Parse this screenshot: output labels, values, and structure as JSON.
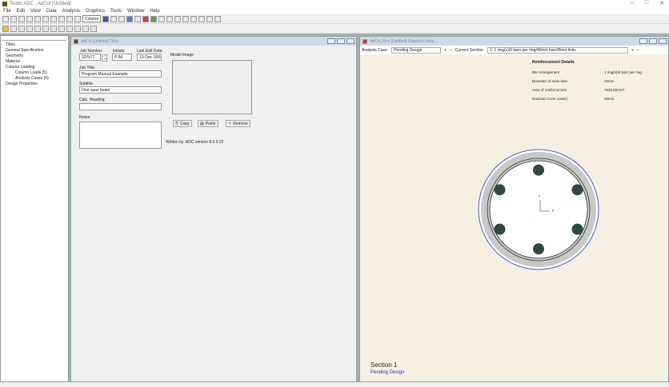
{
  "app": {
    "title": "Tedds ADC - AdCol [Untitled]",
    "min": "–",
    "max": "□",
    "close": "✕"
  },
  "menu": [
    "File",
    "Edit",
    "View",
    "Data",
    "Analysis",
    "Graphics",
    "Tools",
    "Window",
    "Help"
  ],
  "toolbar": {
    "dropdown": "Column"
  },
  "tree": {
    "items": [
      "Titles",
      "General Specification",
      "Geometry",
      "Material",
      "Column Loading"
    ],
    "children": [
      "Column Loads (5)",
      "Analysis Cases (5)"
    ],
    "last": "Design Properties"
  },
  "titles_window": {
    "title": "AdCol [Untitled] Titles",
    "job_number_label": "Job Number:",
    "job_number": "32/5/72",
    "initials_label": "Initials:",
    "initials": "PJM",
    "last_edit_label": "Last Edit Date:",
    "last_edit": "13-Dec-2004",
    "job_title_label": "Job Title:",
    "job_title": "Program Manual Example",
    "subtitle_label": "Subtitle:",
    "subtitle": "One span beam",
    "calc_heading_label": "Calc. Heading:",
    "calc_heading": "",
    "notes_label": "Notes:",
    "notes": "",
    "model_image_label": "Model Image",
    "copy": "Copy",
    "paste": "Paste",
    "remove": "Remove",
    "written_by": "Written by: ADC version 8.0.0.22",
    "browse": "..."
  },
  "graphics_window": {
    "title": "AdCol_Nos [Untitled] Graphics View",
    "analysis_case_label": "Analysis Case:",
    "analysis_case": "Pending Design",
    "current_section_label": "Current Section:",
    "current_section": "1: 1 ring(s)/6 bars per ring/40mm bars/8mm links",
    "details_title": "Reinforcement Details",
    "details": [
      {
        "k": "Bar Arrangement",
        "v": "1 ring(s)/6 bars per ring"
      },
      {
        "k": "Diameter of main bars",
        "v": "40mm"
      },
      {
        "k": "Area of reinforcement",
        "v": "7539.82mm²"
      },
      {
        "k": "Nominal Cover (outer)",
        "v": "30mm"
      }
    ],
    "section_title": "Section 1",
    "section_status": "Pending Design",
    "axis_y": "z",
    "axis_x": "y",
    "colors": {
      "bg": "#f6f0e3",
      "bar": "#2f4a44",
      "outline": "#4a5ad0"
    }
  }
}
